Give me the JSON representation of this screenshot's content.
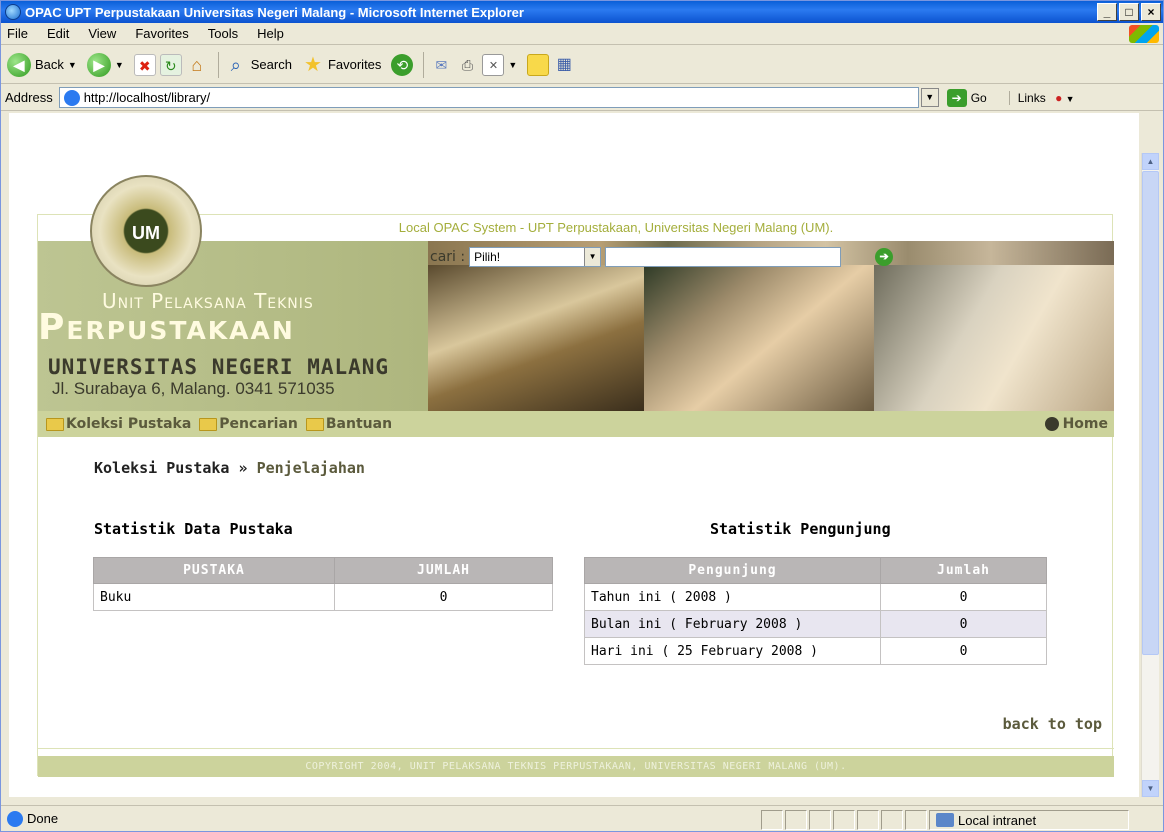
{
  "window": {
    "title": "OPAC UPT Perpustakaan Universitas Negeri Malang - Microsoft Internet Explorer"
  },
  "menu": [
    "File",
    "Edit",
    "View",
    "Favorites",
    "Tools",
    "Help"
  ],
  "toolbar": {
    "back": "Back",
    "search": "Search",
    "favorites": "Favorites"
  },
  "address": {
    "label": "Address",
    "url": "http://localhost/library/",
    "go": "Go",
    "links": "Links"
  },
  "site": {
    "tagline": "Local OPAC System - UPT Perpustakaan, Universitas Negeri Malang (UM).",
    "unit": "Unit Pelaksana Teknis",
    "perpustakaan": "Perpustakaan",
    "universitas": "UNIVERSITAS NEGERI MALANG",
    "address": "Jl. Surabaya 6, Malang. 0341 571035",
    "search_label": "cari :",
    "search_select": "Pilih!",
    "nav": [
      "Koleksi Pustaka",
      "Pencarian",
      "Bantuan"
    ],
    "home": "Home"
  },
  "breadcrumb": {
    "parent": "Koleksi Pustaka",
    "sep": " » ",
    "current": "Penjelajahan"
  },
  "left": {
    "title": "Statistik Data Pustaka",
    "headers": [
      "PUSTAKA",
      "JUMLAH"
    ],
    "rows": [
      [
        "Buku",
        "0"
      ]
    ]
  },
  "right": {
    "title": "Statistik Pengunjung",
    "headers": [
      "Pengunjung",
      "Jumlah"
    ],
    "rows": [
      [
        "Tahun ini ( 2008 )",
        "0"
      ],
      [
        "Bulan ini ( February 2008 )",
        "0"
      ],
      [
        "Hari ini ( 25 February 2008 )",
        "0"
      ]
    ]
  },
  "back_to_top": "back to top",
  "footer": "COPYRIGHT 2004, UNIT PELAKSANA TEKNIS PERPUSTAKAAN, UNIVERSITAS NEGERI MALANG (UM).",
  "status": {
    "left": "Done",
    "right": "Local intranet"
  }
}
